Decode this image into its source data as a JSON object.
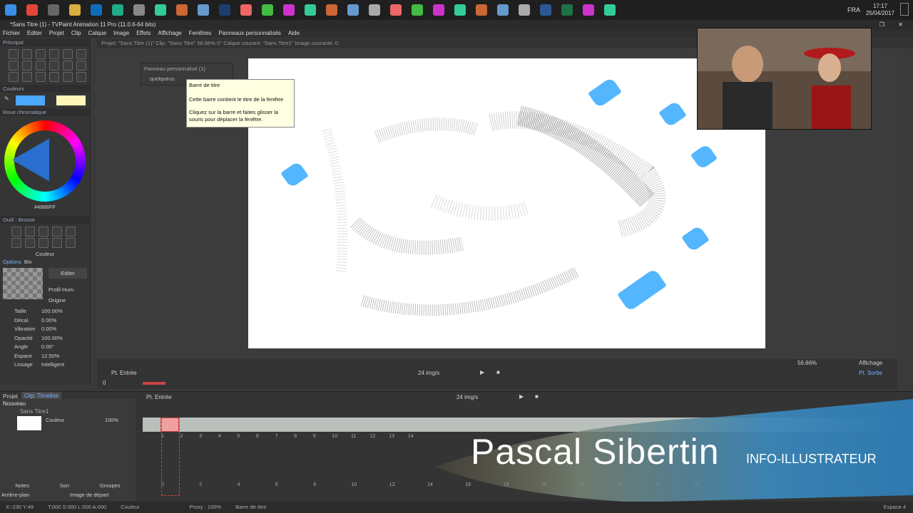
{
  "taskbar": {
    "icons": [
      "windows-icon",
      "chrome-icon",
      "taskview-icon",
      "explorer-icon",
      "outlook-icon",
      "browser-icon",
      "calendar-icon",
      "app-icon",
      "app-icon",
      "app-icon",
      "photoshop-icon",
      "app-icon",
      "app-icon",
      "app-icon",
      "app-icon",
      "app-icon",
      "app-icon",
      "app-icon",
      "app-icon",
      "app-icon",
      "app-icon",
      "app-icon",
      "app-icon",
      "app-icon",
      "app-icon",
      "word-icon",
      "excel-icon",
      "app-icon",
      "app-icon"
    ],
    "lang": "FRA",
    "time": "17:17",
    "date": "25/04/2017"
  },
  "window": {
    "title": "*Sans Titre (1) - TVPaint Animation 11 Pro (11.0.6-64 bits)"
  },
  "menu": [
    "Fichier",
    "Editer",
    "Projet",
    "Clip",
    "Calque",
    "Image",
    "Effets",
    "Affichage",
    "Fenêtres",
    "Panneaux personnalisés",
    "Aide"
  ],
  "infobar": "Projet: \"Sans Titre (1)\"  Clip: \"Sans Titre\"   56.66%   0°  Calque courant: \"Sans Titre1\"   Image courante: 0",
  "left": {
    "principal": "Principal",
    "couleurs": "Couleurs",
    "roue": "Roue chromatique",
    "hex": "#4888FF",
    "outil": "Outil : Brosse",
    "couleur": "Couleur",
    "options": "Options",
    "bin": "Bin",
    "editer": "Editer",
    "profil": "Profil Hum.",
    "origine": "Origine",
    "params": [
      {
        "label": "Taille",
        "value": "100.00%"
      },
      {
        "label": "Décal.",
        "value": "0.00%"
      },
      {
        "label": "Vibration",
        "value": "0.00%"
      },
      {
        "label": "Opacité",
        "value": "100.00%"
      },
      {
        "label": "Angle",
        "value": "0.00°"
      },
      {
        "label": "Espace",
        "value": "12.50%"
      },
      {
        "label": "Lissage",
        "value": "Intelligent"
      }
    ]
  },
  "custom_panel": {
    "title": "Panneau personnalisé (1)",
    "item": "quelqueus"
  },
  "tooltip": {
    "title": "Barre de titre",
    "line1": "Cette barre contient le titre de la fenêtre",
    "line2": "Cliquez sur la barre et faites glisser la souris pour déplacer la fenêtre."
  },
  "canvas_status": {
    "zoom": "56.66%",
    "affichage": "Affichage",
    "sortie": "Pt. Sortie"
  },
  "transport": {
    "entree": "Pt. Entrée",
    "fps": "24 img/s",
    "start": "0"
  },
  "timeline": {
    "project": "Projet",
    "clip_tab": "Clip: Timeline",
    "entree": "Pt. Entrée",
    "fps": "24 img/s",
    "nouveau": "Nouveau",
    "layer_name": "Sans Titre1",
    "couleur": "Couleur",
    "opacity": "100%",
    "frame_numbers": [
      "1",
      "2",
      "3",
      "4",
      "5",
      "6",
      "7",
      "8",
      "9",
      "10",
      "11",
      "12",
      "13",
      "14"
    ],
    "ruler": [
      "0",
      "2",
      "4",
      "6",
      "8",
      "10",
      "12",
      "14",
      "16",
      "18",
      "20",
      "22",
      "24",
      "26",
      "28",
      "30",
      "32",
      "34"
    ],
    "bottom_tabs": [
      "Notes",
      "Son",
      "Groupes"
    ],
    "arriere": "Arrière-plan",
    "image_depart": "Image de départ"
  },
  "statusbar": {
    "coords": "X:-230  Y:49",
    "timecode": "T:000 S:000 L:000 A:000",
    "couleur": "Couleur",
    "proxy": "Proxy : 100%",
    "barre": "Barre de titre",
    "espace": "Espace 4"
  },
  "overlay": {
    "name": "Pascal Sibertin",
    "role": "INFO-ILLUSTRATEUR"
  },
  "colors": {
    "accent_blue": "#4ab2ff",
    "fg_swatch": "#4aa8ff",
    "bg_swatch": "#fff6b8"
  }
}
